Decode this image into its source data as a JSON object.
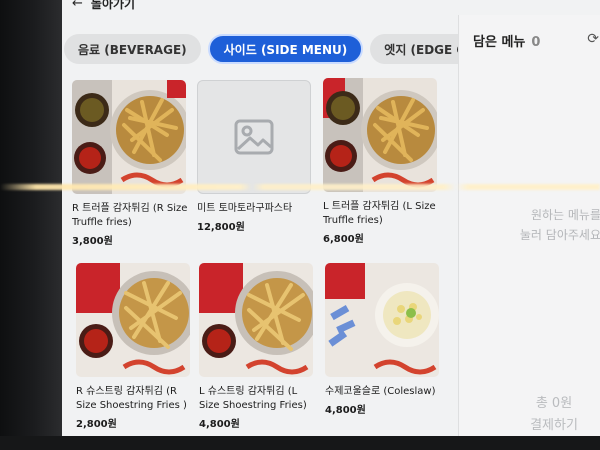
{
  "header": {
    "back_label": "돌아가기"
  },
  "tabs": [
    {
      "label": "음료 (BEVERAGE)",
      "active": false
    },
    {
      "label": "사이드 (SIDE MENU)",
      "active": true
    },
    {
      "label": "엣지 (EDGE OPTION",
      "active": false
    }
  ],
  "cart": {
    "title": "담은 메뉴",
    "count": "0",
    "empty_line1": "원하는 메뉴를",
    "empty_line2": "눌러 담아주세요",
    "total": "총 0원",
    "pay": "결제하기"
  },
  "products": [
    {
      "name": "R 트러플 감자튀김 (R Size Truffle fries)",
      "price": "3,800원",
      "image": "truffle-fries-photo"
    },
    {
      "name": "미트 토마토라구파스타",
      "price": "12,800원",
      "image": "placeholder-image-icon"
    },
    {
      "name": "L 트러플 감자튀김 (L Size Truffle fries)",
      "price": "6,800원",
      "image": "truffle-fries-photo"
    },
    {
      "name": "R 슈스트링 감자튀김 (R Size Shoestring Fries )",
      "price": "2,800원",
      "image": "shoestring-fries-photo"
    },
    {
      "name": "L 슈스트링 감자튀김 (L Size Shoestring Fries)",
      "price": "4,800원",
      "image": "shoestring-fries-photo"
    },
    {
      "name": "수제코울슬로 (Coleslaw)",
      "price": "4,800원",
      "image": "coleslaw-photo"
    }
  ],
  "colors": {
    "accent": "#1e5fd8",
    "screen_bg": "#f1f2f3"
  }
}
